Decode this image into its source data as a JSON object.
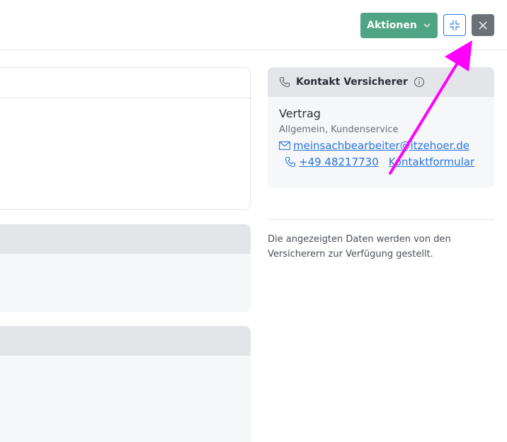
{
  "toolbar": {
    "actions_label": "Aktionen",
    "collapse_icon": "collapse-icon",
    "close_icon": "close-icon"
  },
  "contact": {
    "title": "Kontakt Versicherer",
    "contract": "Vertrag",
    "subtitle": "Allgemein, Kundenservice",
    "email": "meinsachbearbeiter@itzehoer.de",
    "phone": "+49 48217730",
    "form_link": "Kontaktformular"
  },
  "note": "Die angezeigten Daten werden von den Versicherern zur Verfügung gestellt.",
  "colors": {
    "accent_green": "#4ea485",
    "link_blue": "#2a75e0",
    "annotation_magenta": "#ff00ff"
  }
}
